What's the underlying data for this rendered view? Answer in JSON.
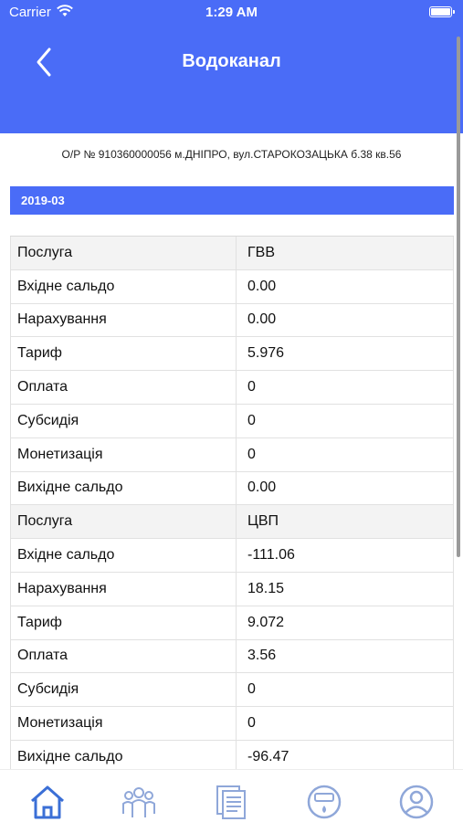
{
  "status_bar": {
    "carrier": "Carrier",
    "time": "1:29 AM"
  },
  "navbar": {
    "title": "Водоканал"
  },
  "account": {
    "text": "О/Р № 910360000056 м.ДНІПРО, вул.СТАРОКОЗАЦЬКА б.38 кв.56"
  },
  "period": {
    "label": "2019-03"
  },
  "rows": [
    {
      "label": "Послуга",
      "value": "ГВВ",
      "header": true
    },
    {
      "label": "Вхідне сальдо",
      "value": "0.00"
    },
    {
      "label": "Нарахування",
      "value": "0.00"
    },
    {
      "label": "Тариф",
      "value": "5.976"
    },
    {
      "label": "Оплата",
      "value": "0"
    },
    {
      "label": "Субсидія",
      "value": "0"
    },
    {
      "label": "Монетизація",
      "value": "0"
    },
    {
      "label": "Вихідне сальдо",
      "value": "0.00"
    },
    {
      "label": "Послуга",
      "value": "ЦВП",
      "header": true
    },
    {
      "label": "Вхідне сальдо",
      "value": "-111.06"
    },
    {
      "label": "Нарахування",
      "value": "18.15"
    },
    {
      "label": "Тариф",
      "value": "9.072"
    },
    {
      "label": "Оплата",
      "value": "3.56"
    },
    {
      "label": "Субсидія",
      "value": "0"
    },
    {
      "label": "Монетизація",
      "value": "0"
    },
    {
      "label": "Вихідне сальдо",
      "value": "-96.47"
    }
  ],
  "tabs": [
    {
      "icon": "home-icon",
      "active": true
    },
    {
      "icon": "people-icon",
      "active": false
    },
    {
      "icon": "documents-icon",
      "active": false
    },
    {
      "icon": "meter-icon",
      "active": false
    },
    {
      "icon": "profile-icon",
      "active": false
    }
  ],
  "colors": {
    "accent": "#4a6cf7",
    "tab_active": "#3b6fd6",
    "tab_inactive": "#8fa7d9"
  }
}
